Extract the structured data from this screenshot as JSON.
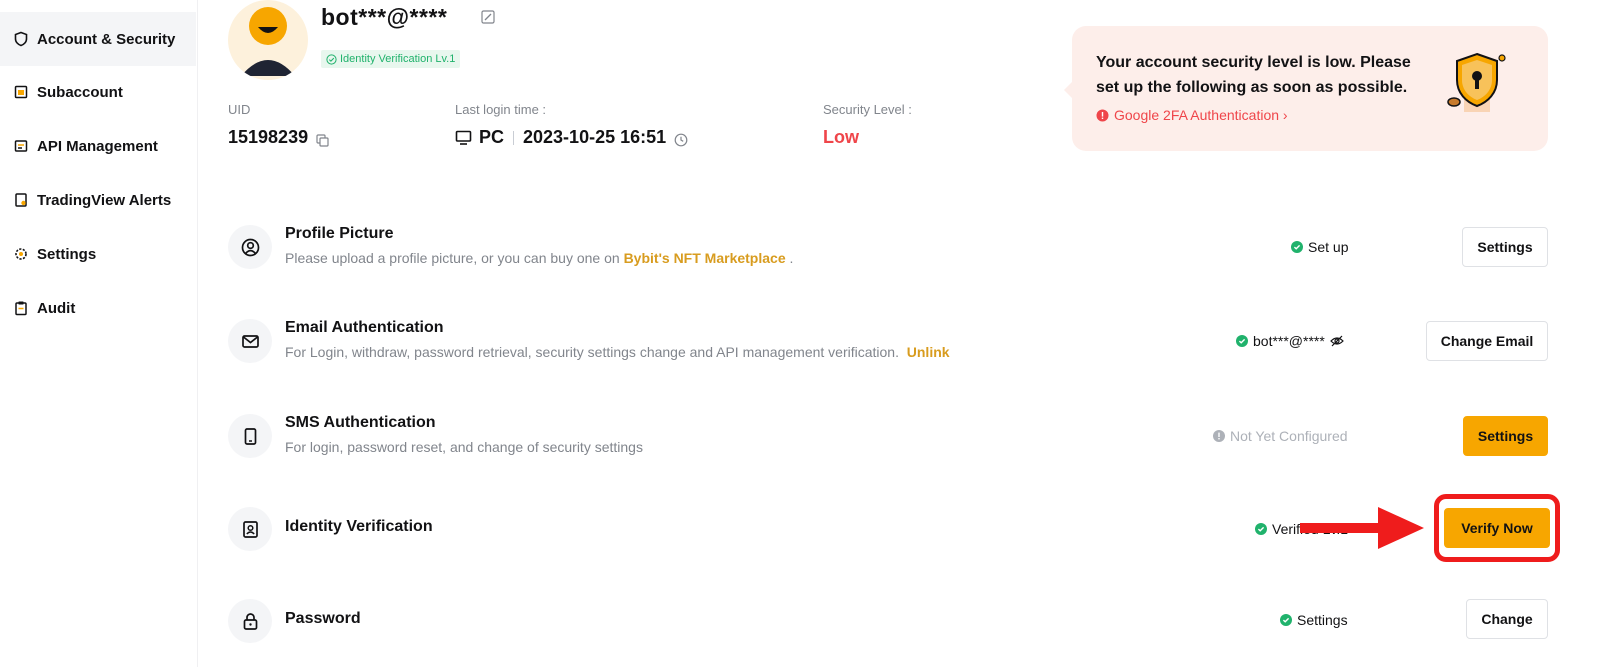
{
  "sidebar": {
    "items": [
      {
        "label": "Account & Security",
        "icon": "shield-icon",
        "active": true
      },
      {
        "label": "Subaccount",
        "icon": "subaccount-icon"
      },
      {
        "label": "API Management",
        "icon": "api-icon"
      },
      {
        "label": "TradingView Alerts",
        "icon": "alert-doc-icon"
      },
      {
        "label": "Settings",
        "icon": "gear-icon"
      },
      {
        "label": "Audit",
        "icon": "clipboard-icon"
      }
    ]
  },
  "profile": {
    "username": "bot***@****",
    "verification_badge": "Identity Verification Lv.1",
    "uid_label": "UID",
    "uid": "15198239",
    "last_login_label": "Last login time :",
    "last_login_device": "PC",
    "last_login_time": "2023-10-25 16:51",
    "security_level_label": "Security Level :",
    "security_level": "Low"
  },
  "alert": {
    "message": "Your account security level is low. Please set up the following as soon as possible.",
    "link": "Google 2FA Authentication ›"
  },
  "rows": [
    {
      "title": "Profile Picture",
      "desc": "Please upload a profile picture, or you can buy one on ",
      "desc_link": "Bybit's NFT Marketplace",
      "desc_suffix": " .",
      "status": "Set up",
      "button": "Settings"
    },
    {
      "title": "Email Authentication",
      "desc": "For Login, withdraw, password retrieval, security settings change and API management verification.",
      "desc_link": "Unlink",
      "status": "bot***@****",
      "button": "Change Email"
    },
    {
      "title": "SMS Authentication",
      "desc": "For login, password reset, and change of security settings",
      "status": "Not Yet Configured",
      "button": "Settings"
    },
    {
      "title": "Identity Verification",
      "status": "Verified Lv.1",
      "button": "Verify Now"
    },
    {
      "title": "Password",
      "status": "Settings",
      "button": "Change"
    }
  ],
  "colors": {
    "accent": "#f7a600",
    "success": "#20b26c",
    "danger": "#ef454a",
    "link": "#d89c1f",
    "annotation": "#ef1c1c"
  }
}
